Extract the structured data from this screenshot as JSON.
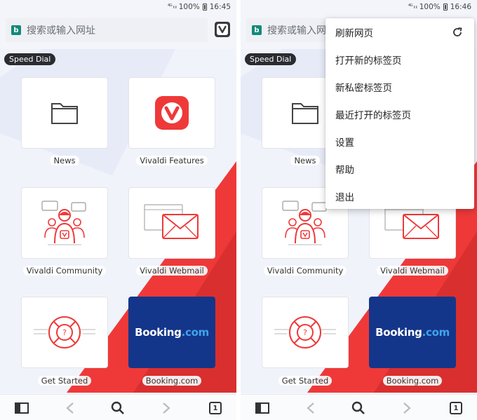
{
  "left_screen": {
    "status": {
      "signal": "⁴ᴳ ᵢₗ ᵢₗ",
      "battery": "100%",
      "time": "16:45"
    },
    "address": {
      "placeholder": "搜索或输入网址"
    },
    "speed_dial_label": "Speed Dial",
    "tiles": [
      {
        "label": "News",
        "icon": "folder-icon"
      },
      {
        "label": "Vivaldi Features",
        "icon": "vivaldi-logo"
      },
      {
        "label": "Vivaldi Community",
        "icon": "community-icon"
      },
      {
        "label": "Vivaldi Webmail",
        "icon": "mail-icon"
      },
      {
        "label": "Get Started",
        "icon": "lifebuoy-icon"
      },
      {
        "label": "Booking.com",
        "brand": "Booking",
        "brand_tld": ".com"
      }
    ],
    "bottom": {
      "tab_count": "1"
    }
  },
  "right_screen": {
    "status": {
      "signal": "⁴ᴳ ᵢₗ ᵢₗ",
      "battery": "100%",
      "time": "16:46"
    },
    "address": {
      "placeholder": "搜索或输入网"
    },
    "speed_dial_label": "Speed Dial",
    "tiles": [
      {
        "label": "News"
      },
      {
        "label": "Vivaldi Community"
      },
      {
        "label": "Vivaldi Webmail"
      },
      {
        "label": "Get Started"
      },
      {
        "label": "Booking.com",
        "brand": "Booking",
        "brand_tld": ".com"
      }
    ],
    "menu": [
      {
        "label": "刷新网页",
        "icon": "refresh-icon"
      },
      {
        "label": "打开新的标签页"
      },
      {
        "label": "新私密标签页"
      },
      {
        "label": "最近打开的标签页"
      },
      {
        "label": "设置"
      },
      {
        "label": "帮助"
      },
      {
        "label": "退出"
      }
    ],
    "bottom": {
      "tab_count": "1"
    }
  },
  "colors": {
    "vivaldi_red": "#ef3939",
    "booking_blue": "#14368a",
    "booking_dot": "#3fa3ea",
    "pill_dark": "#2a2c31"
  }
}
